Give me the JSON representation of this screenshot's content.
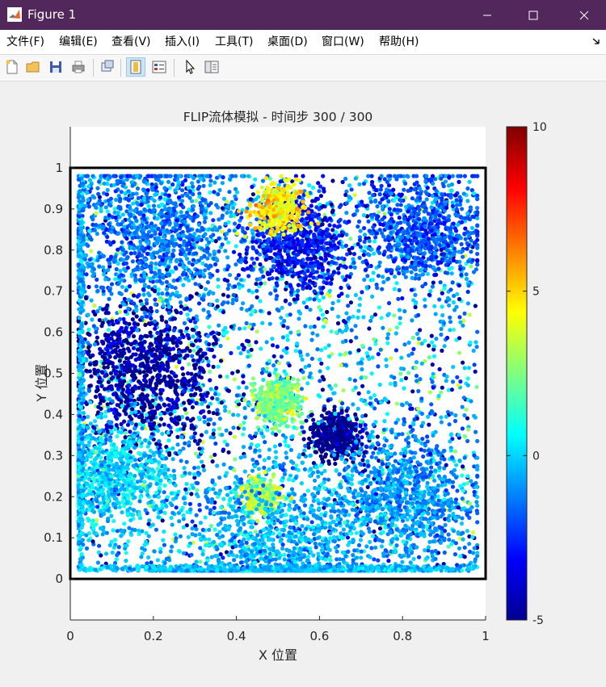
{
  "window": {
    "title": "Figure 1",
    "icons": {
      "app": "matlab-icon",
      "minimize": "minimize-icon",
      "maximize": "maximize-icon",
      "close": "close-icon"
    }
  },
  "menu": {
    "items": [
      "文件(F)",
      "编辑(E)",
      "查看(V)",
      "插入(I)",
      "工具(T)",
      "桌面(D)",
      "窗口(W)",
      "帮助(H)"
    ]
  },
  "toolbar": {
    "buttons": [
      "new-figure-icon",
      "open-folder-icon",
      "save-icon",
      "print-icon",
      "link-plot-icon",
      "colorbar-toggle-icon",
      "legend-toggle-icon",
      "pointer-icon",
      "property-editor-icon"
    ]
  },
  "chart_data": {
    "type": "scatter",
    "title": "FLIP流体模拟 - 时间步 300 / 300",
    "xlabel": "X 位置",
    "ylabel": "Y 位置",
    "xlim": [
      0,
      1
    ],
    "ylim": [
      -0.1,
      1.1
    ],
    "xticks": [
      "0",
      "0.2",
      "0.4",
      "0.6",
      "0.8",
      "1"
    ],
    "yticks": [
      "0",
      "0.1",
      "0.2",
      "0.3",
      "0.4",
      "0.5",
      "0.6",
      "0.7",
      "0.8",
      "0.9",
      "1"
    ],
    "container_box": {
      "x": [
        0,
        1
      ],
      "y": [
        0,
        1
      ]
    },
    "particle_extent": {
      "x": [
        0.02,
        0.98
      ],
      "y": [
        0.02,
        0.98
      ]
    },
    "colormap": "jet",
    "colorbar": {
      "limits": [
        -5,
        10
      ],
      "ticks": [
        "-5",
        "0",
        "5",
        "10"
      ],
      "location": "right"
    },
    "colors": {
      "boundary": "#000000",
      "axes": "#262626",
      "background": "#ffffff"
    },
    "grid": false,
    "particle_clusters": [
      {
        "center": [
          0.85,
          0.85
        ],
        "spread": 0.07,
        "value": -2
      },
      {
        "center": [
          0.55,
          0.82
        ],
        "spread": 0.06,
        "value": -3
      },
      {
        "center": [
          0.18,
          0.5
        ],
        "spread": 0.09,
        "value": -4.5
      },
      {
        "center": [
          0.2,
          0.85
        ],
        "spread": 0.1,
        "value": -1.5
      },
      {
        "center": [
          0.5,
          0.9
        ],
        "spread": 0.03,
        "value": 4.5
      },
      {
        "center": [
          0.46,
          0.2
        ],
        "spread": 0.02,
        "value": 3.5
      },
      {
        "center": [
          0.5,
          0.43
        ],
        "spread": 0.03,
        "value": 2.5
      },
      {
        "center": [
          0.64,
          0.35
        ],
        "spread": 0.03,
        "value": -5
      },
      {
        "center": [
          0.8,
          0.2
        ],
        "spread": 0.08,
        "value": -1
      },
      {
        "center": [
          0.1,
          0.25
        ],
        "spread": 0.07,
        "value": 0
      },
      {
        "center": [
          0.5,
          0.05
        ],
        "spread": 0.12,
        "value": -0.5
      }
    ]
  }
}
